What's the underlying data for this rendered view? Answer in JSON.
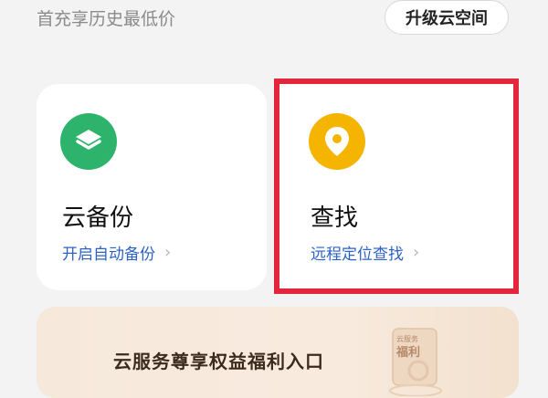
{
  "header": {
    "promo_text": "首充享历史最低价",
    "upgrade_label": "升级云空间"
  },
  "cards": [
    {
      "title": "云备份",
      "link_label": "开启自动备份",
      "icon": "layers-icon",
      "icon_color": "#2db36b"
    },
    {
      "title": "查找",
      "link_label": "远程定位查找",
      "icon": "location-pin-icon",
      "icon_color": "#f4b400"
    }
  ],
  "banner": {
    "text": "云服务尊享权益福利入口",
    "gift_badge_text": "福利",
    "gift_small_text": "云服务"
  },
  "colors": {
    "accent_blue": "#2d62c8",
    "highlight_red": "#e3263b"
  }
}
